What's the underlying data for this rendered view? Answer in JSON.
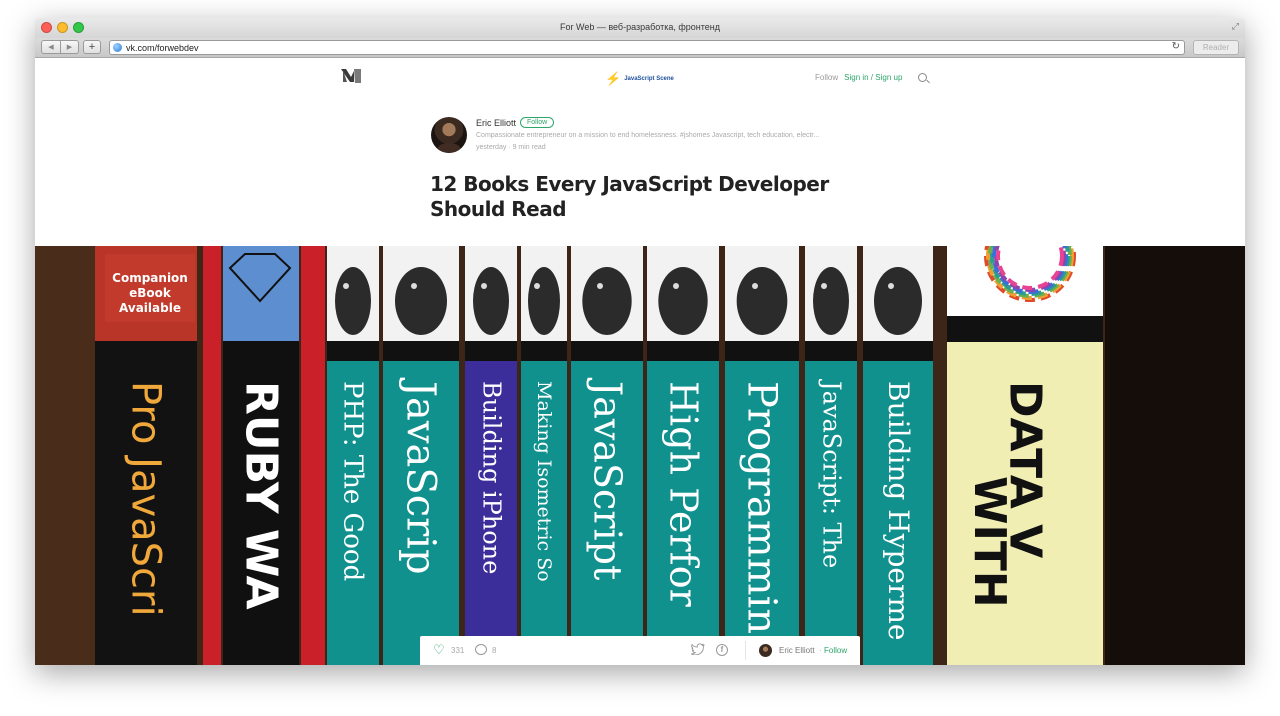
{
  "browser": {
    "window_title": "For Web — веб-разработка, фронтенд",
    "url": "vk.com/forwebdev",
    "reader_label": "Reader",
    "back_label": "◀",
    "forward_label": "▶",
    "new_tab_label": "+",
    "reload_glyph": "↻",
    "fullscreen_glyph": "⤢"
  },
  "nav": {
    "publication": "JavaScript Scene",
    "follow_label": "Follow",
    "signin_label": "Sign in / Sign up"
  },
  "author": {
    "name": "Eric Elliott",
    "follow_label": "Follow",
    "bio": "Compassionate entrepreneur on a mission to end homelessness. #jshomes Javascript, tech education, electr...",
    "meta": "yesterday · 9 min read"
  },
  "article": {
    "title": "12 Books Every JavaScript Developer Should Read"
  },
  "hero": {
    "companion_badge": [
      "Companion",
      "eBook",
      "Available"
    ],
    "spines": [
      "Pro JavaScri",
      "RUBY WA",
      "PHP: The Good",
      "JavaScrip",
      "Building iPhone",
      "Making Isometric So",
      "JavaScript",
      "High Perfor",
      "Programming",
      "JavaScript: The",
      "Building Hyperme",
      "DATA V",
      "WITH"
    ]
  },
  "actions": {
    "likes": "331",
    "comments": "8",
    "author": "Eric Elliott",
    "separator": "·",
    "follow_label": "Follow"
  },
  "colors": {
    "accent": "#2fa56a",
    "teal_spine": "#11918e",
    "purple_spine": "#3b2e9a",
    "red_spine": "#c9202a",
    "yellow_spine": "#f1eeb4"
  }
}
